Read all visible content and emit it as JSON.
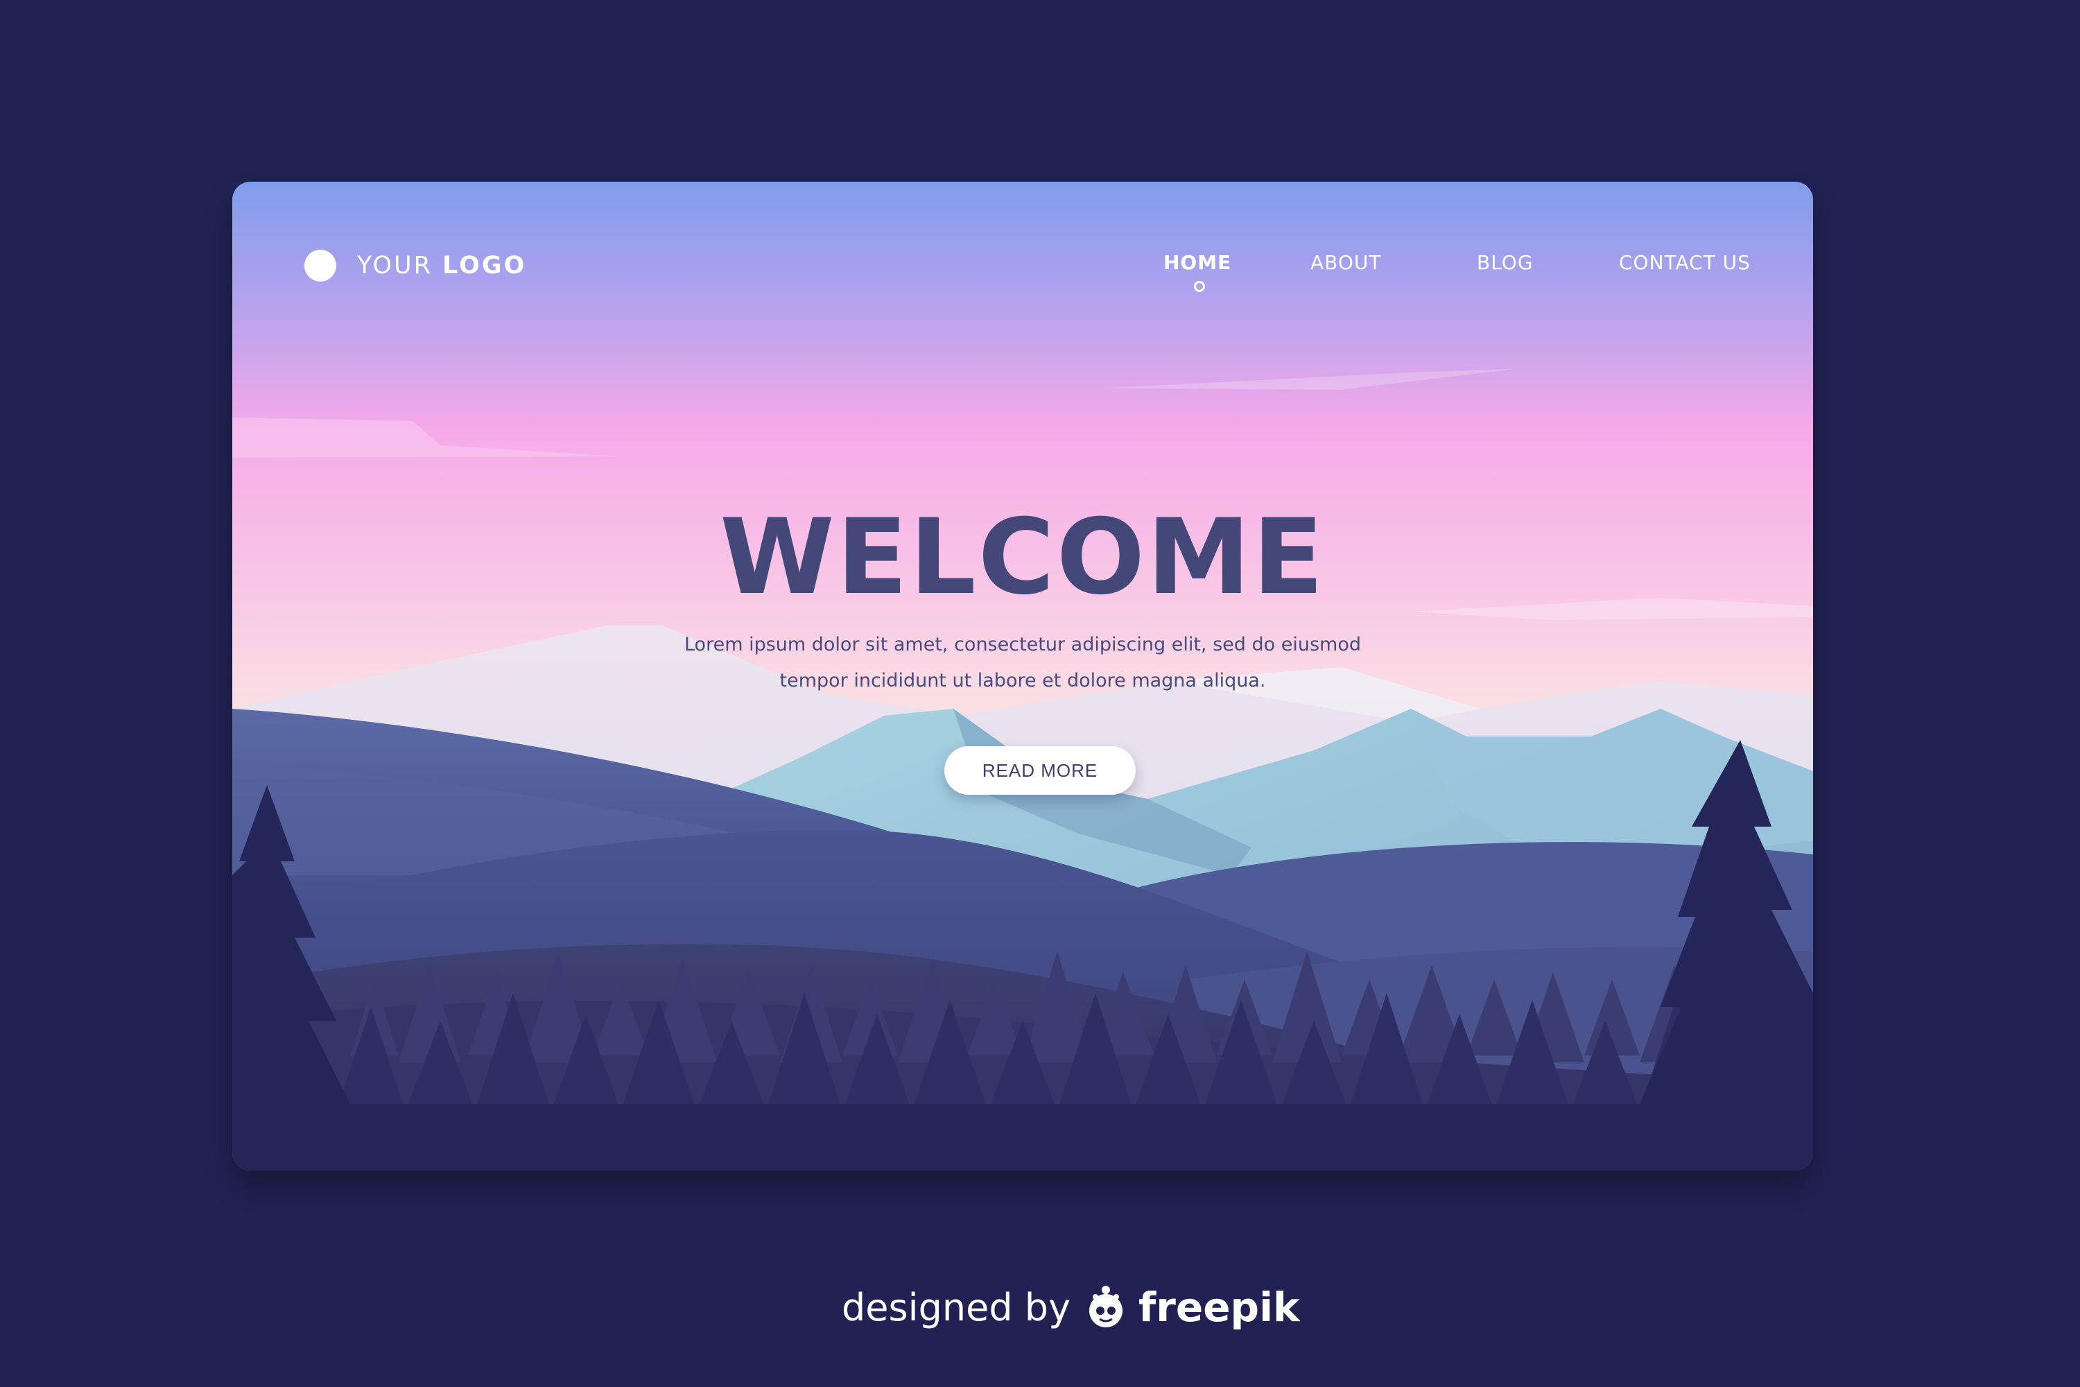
{
  "logo": {
    "prefix": "YOUR",
    "bold": "LOGO"
  },
  "nav": {
    "items": [
      {
        "label": "HOME",
        "active": true
      },
      {
        "label": "ABOUT",
        "active": false
      },
      {
        "label": "BLOG",
        "active": false
      },
      {
        "label": "CONTACT US",
        "active": false
      }
    ]
  },
  "hero": {
    "title": "WELCOME",
    "line1": "Lorem ipsum dolor sit amet, consectetur adipiscing elit, sed do eiusmod",
    "line2": "tempor incididunt ut labore et dolore magna aliqua.",
    "button": "READ MORE"
  },
  "credit": {
    "prefix": "designed by",
    "brand": "freepik"
  },
  "colors": {
    "background": "#212253",
    "sky_top": "#7f9deb",
    "sky_mid": "#f6a9e9",
    "sky_bottom": "#fbe3e3",
    "title": "#444878",
    "forest": "#242559"
  },
  "icons": {
    "logo": "circle-logo-icon",
    "credit": "freepik-mascot-icon"
  }
}
